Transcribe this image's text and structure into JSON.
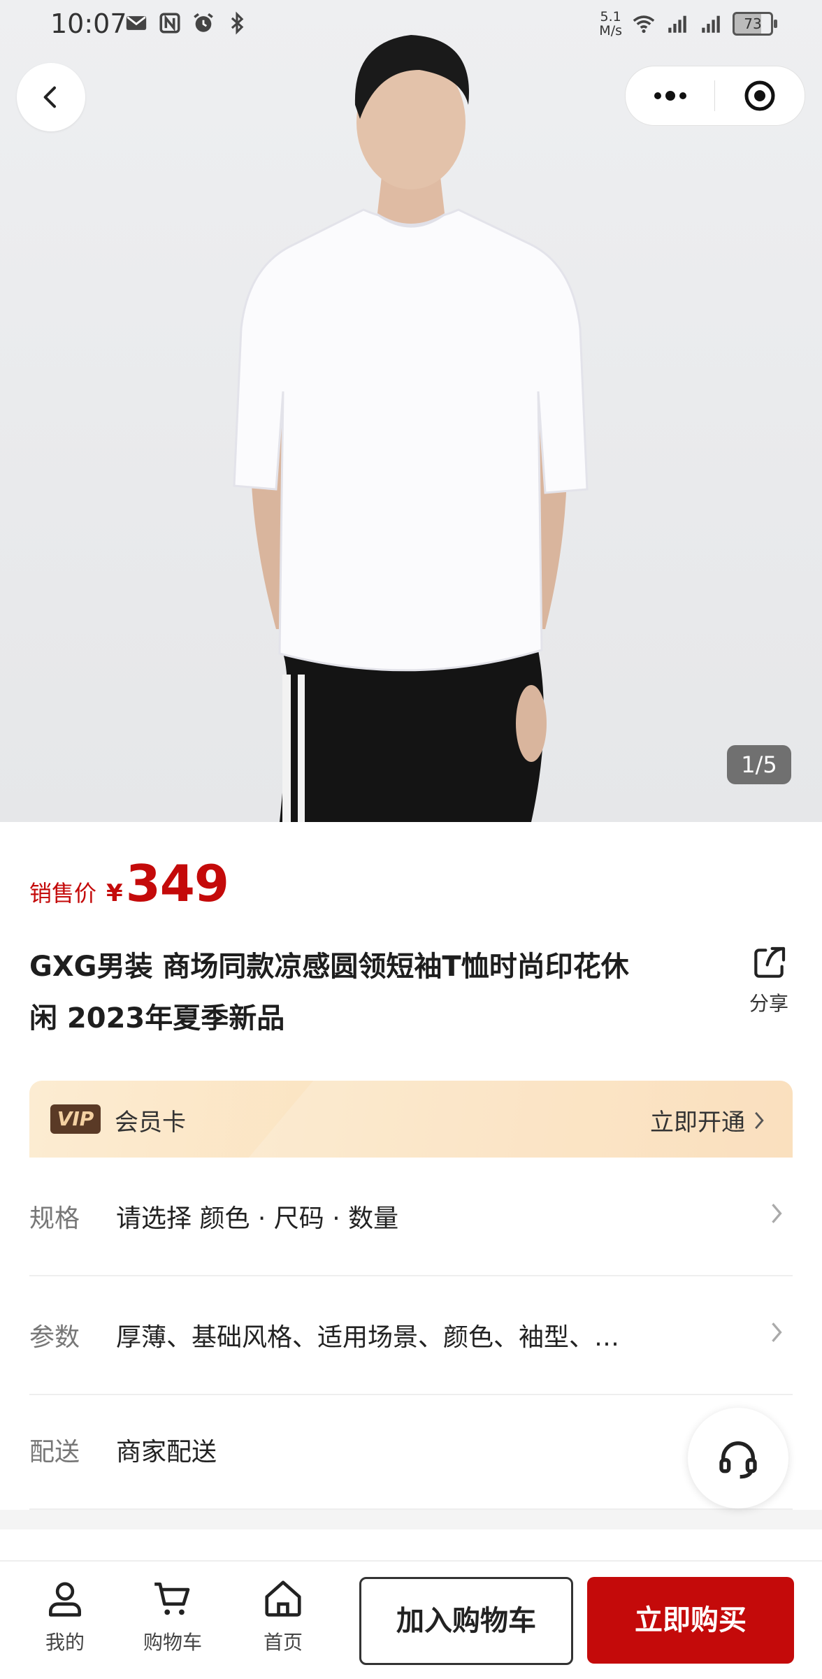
{
  "status_bar": {
    "time": "10:07",
    "net_speed_value": "5.1",
    "net_speed_unit": "M/s",
    "battery": "73",
    "icons": [
      "mail-icon",
      "nfc-icon",
      "alarm-icon",
      "bluetooth-icon",
      "wifi-icon",
      "signal-4g-icon",
      "signal-5g-icon"
    ]
  },
  "top_bar": {
    "back_icon": "chevron-left-icon",
    "more_icon": "more-dots-icon",
    "close_icon": "target-close-icon"
  },
  "gallery": {
    "counter": "1/5",
    "current": 1,
    "total": 5
  },
  "price": {
    "label": "销售价",
    "currency": "¥",
    "value": "349",
    "color": "#c40a0a"
  },
  "product": {
    "title_line1": "GXG男装 商场同款凉感圆领短袖T恤时尚印花休",
    "title_line2": "闲 2023年夏季新品",
    "share_label": "分享"
  },
  "vip": {
    "badge": "VIP",
    "label": "会员卡",
    "action": "立即开通"
  },
  "rows": [
    {
      "label": "规格",
      "value": "请选择 颜色 · 尺码 · 数量",
      "has_chevron": true
    },
    {
      "label": "参数",
      "value": "厚薄、基础风格、适用场景、颜色、袖型、…",
      "has_chevron": true
    },
    {
      "label": "配送",
      "value": "商家配送",
      "has_chevron": false
    }
  ],
  "bottom_nav": {
    "items": [
      {
        "label": "我的",
        "icon": "user-icon"
      },
      {
        "label": "购物车",
        "icon": "cart-icon"
      },
      {
        "label": "首页",
        "icon": "home-icon"
      }
    ],
    "add_to_cart": "加入购物车",
    "buy_now": "立即购买"
  },
  "colors": {
    "accent": "#c40a0a",
    "vip_gradient_start": "#fcecd2",
    "vip_gradient_end": "#f9d9b0"
  }
}
